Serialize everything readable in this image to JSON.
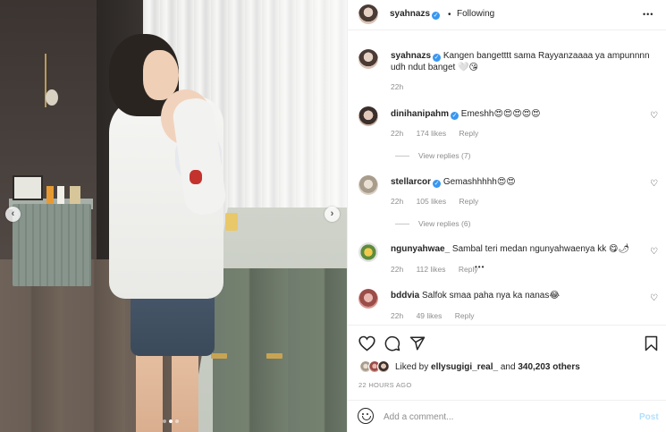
{
  "post": {
    "author": "syahnazs",
    "follow_separator": "•",
    "follow_label": "Following",
    "more_label": "•••",
    "caption": "Kangen bangetttt sama Rayyanzaaaa ya ampunnnn udh ndut banget 🤍😘",
    "caption_time": "22h"
  },
  "media": {
    "carousel_total": 3,
    "carousel_active_index": 1,
    "prev_label": "‹",
    "next_label": "›"
  },
  "comments": [
    {
      "user": "dinihanipahm",
      "verified": true,
      "text": "Emeshh😍😍😍😍😍",
      "time": "22h",
      "likes": "174 likes",
      "reply": "Reply",
      "view_replies": "View replies (7)"
    },
    {
      "user": "stellarcor",
      "verified": true,
      "text": "Gemashhhhh😍😍",
      "time": "22h",
      "likes": "105 likes",
      "reply": "Reply",
      "view_replies": "View replies (6)"
    },
    {
      "user": "ngunyahwae_",
      "verified": false,
      "text": "Sambal teri medan ngunyahwaenya kk 😋🌶",
      "time": "22h",
      "likes": "112 likes",
      "reply": "Reply",
      "more": "•••"
    },
    {
      "user": "bddvia",
      "verified": false,
      "text": "Salfok smaa paha nya ka nanas😂",
      "time": "22h",
      "likes": "49 likes",
      "reply": "Reply"
    }
  ],
  "footer": {
    "liked_prefix": "Liked by ",
    "liked_user": "ellysugigi_real_",
    "liked_middle": " and ",
    "liked_count": "340,203 others",
    "time_ago": "22 HOURS AGO",
    "comment_placeholder": "Add a comment...",
    "post_label": "Post"
  },
  "icons": {
    "heart": "♡",
    "comment": "◯",
    "share": "➢",
    "bookmark": "bookmark-icon",
    "verified": "✓"
  },
  "colors": {
    "verified_blue": "#3897f0",
    "post_button_disabled": "#b2dffc",
    "muted_text": "#8e8e8e"
  }
}
